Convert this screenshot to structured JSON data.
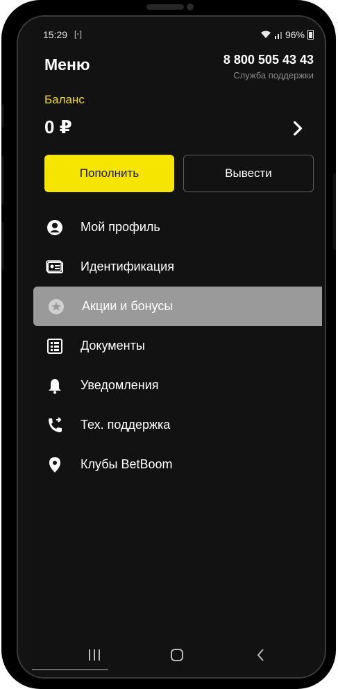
{
  "status_bar": {
    "time": "15:29",
    "screen_icon": "[◦]",
    "battery": "96%"
  },
  "header": {
    "title": "Меню",
    "phone": "8 800 505 43 43",
    "support": "Служба поддержки"
  },
  "balance": {
    "label": "Баланс",
    "amount": "0 ₽"
  },
  "actions": {
    "deposit": "Пополнить",
    "withdraw": "Вывести"
  },
  "menu": {
    "items": [
      {
        "label": "Мой профиль",
        "icon": "account-circle-icon"
      },
      {
        "label": "Идентификация",
        "icon": "id-card-icon"
      },
      {
        "label": "Акции и бонусы",
        "icon": "star-circle-icon",
        "active": true
      },
      {
        "label": "Документы",
        "icon": "document-list-icon"
      },
      {
        "label": "Уведомления",
        "icon": "bell-icon"
      },
      {
        "label": "Тех. поддержка",
        "icon": "phone-forward-icon"
      },
      {
        "label": "Клубы BetBoom",
        "icon": "location-pin-icon"
      }
    ]
  },
  "colors": {
    "accent": "#f6e500",
    "balance_label": "#f2da1c",
    "background": "#121212",
    "active_item": "#9a9a9a"
  }
}
